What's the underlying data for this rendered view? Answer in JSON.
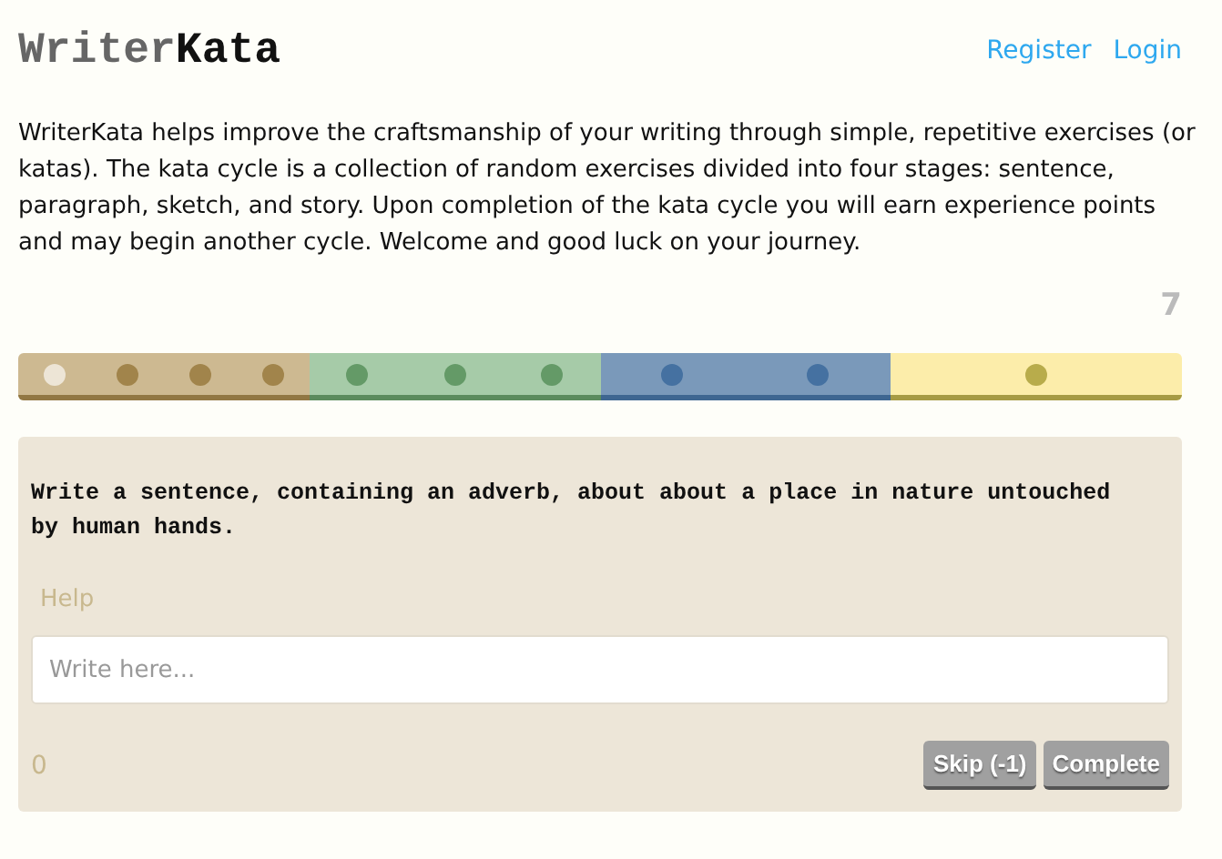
{
  "header": {
    "logo": {
      "first": "Writer",
      "second": "Kata"
    },
    "links": [
      "Register",
      "Login"
    ]
  },
  "intro": "WriterKata helps improve the craftsmanship of your writing through simple, repetitive exercises (or katas). The kata cycle is a collection of random exercises divided into four stages: sentence, paragraph, sketch, and story. Upon completion of the kata cycle you will earn experience points and may begin another cycle. Welcome and good luck on your journey.",
  "points": "7",
  "stages": [
    {
      "color": "#cdb991",
      "dots": [
        {
          "current": true
        },
        {
          "current": false
        },
        {
          "current": false
        },
        {
          "current": false
        }
      ]
    },
    {
      "color": "#a6cba8",
      "dots": [
        {
          "current": false
        },
        {
          "current": false
        },
        {
          "current": false
        }
      ]
    },
    {
      "color": "#7a99ba",
      "dots": [
        {
          "current": false
        },
        {
          "current": false
        }
      ]
    },
    {
      "color": "#fcedaa",
      "dots": [
        {
          "current": false
        }
      ]
    }
  ],
  "exercise": {
    "prompt": "Write a sentence, containing an adverb, about about a place in nature untouched by human hands.",
    "help": "Help",
    "placeholder": "Write here...",
    "word_count": "0",
    "buttons": [
      "Skip (-1)",
      "Complete"
    ]
  }
}
